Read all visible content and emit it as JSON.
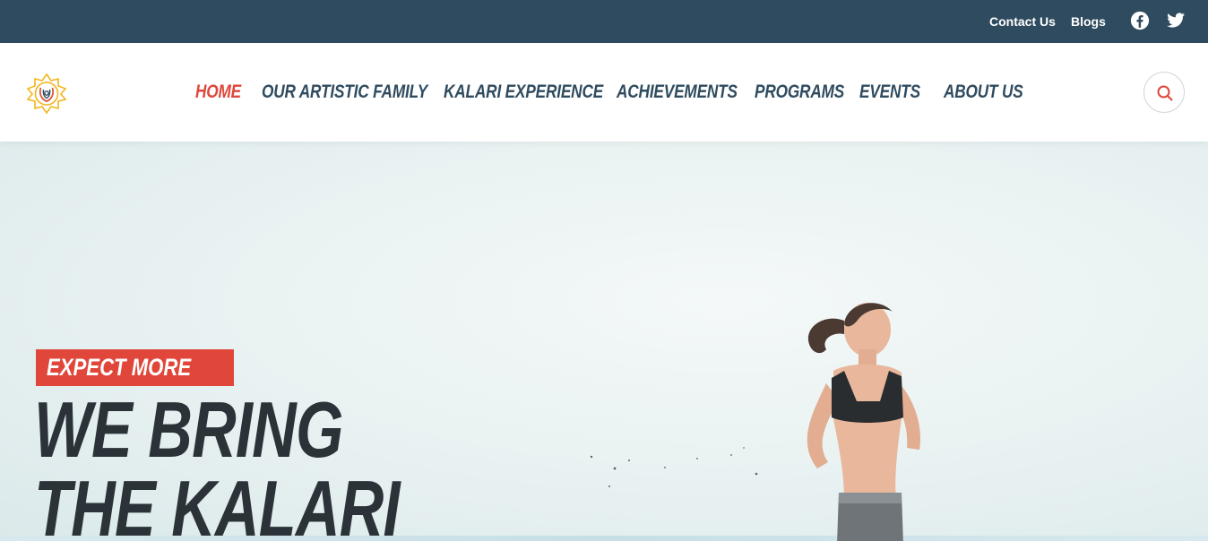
{
  "topbar": {
    "links": [
      "Contact Us",
      "Blogs"
    ],
    "social_icons": [
      "facebook-icon",
      "twitter-icon"
    ],
    "background": "#2f4b5f"
  },
  "nav": {
    "logo_icon": "lotus-logo-icon",
    "items": [
      "HOME",
      "OUR ARTISTIC FAMILY",
      "KALARI EXPERIENCE",
      "ACHIEVEMENTS",
      "PROGRAMS",
      "EVENTS",
      "ABOUT US"
    ],
    "active_index": 0,
    "active_color": "#e0463a",
    "search_icon": "search-icon"
  },
  "hero": {
    "badge": "EXPECT MORE",
    "headline_line1": "WE BRING",
    "headline_line2": "THE KALARI",
    "accent_color": "#e0463a",
    "image": "woman-running-on-beach"
  }
}
